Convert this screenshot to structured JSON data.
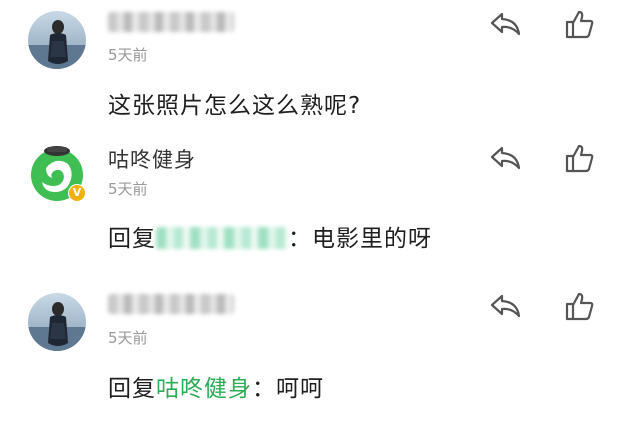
{
  "comments": [
    {
      "time": "5天前",
      "text": "这张照片怎么这么熟呢?",
      "avatar_icon": "person-avatar-icon"
    },
    {
      "username": "咕咚健身",
      "time": "5天前",
      "reply_prefix": "回复",
      "reply_sep": "：",
      "reply_text": "电影里的呀",
      "avatar_icon": "codoon-logo-avatar-icon",
      "badge": "V"
    },
    {
      "time": "5天前",
      "reply_prefix": "回复",
      "mention": "咕咚健身",
      "reply_sep": "：",
      "reply_text": "呵呵",
      "avatar_icon": "person-avatar-icon"
    }
  ],
  "colors": {
    "mention": "#2eab56",
    "meta": "#999999",
    "icon": "#555555",
    "badge": "#f2b20d"
  },
  "icons": {
    "reply": "reply-arrow-icon",
    "like": "thumbs-up-icon"
  }
}
